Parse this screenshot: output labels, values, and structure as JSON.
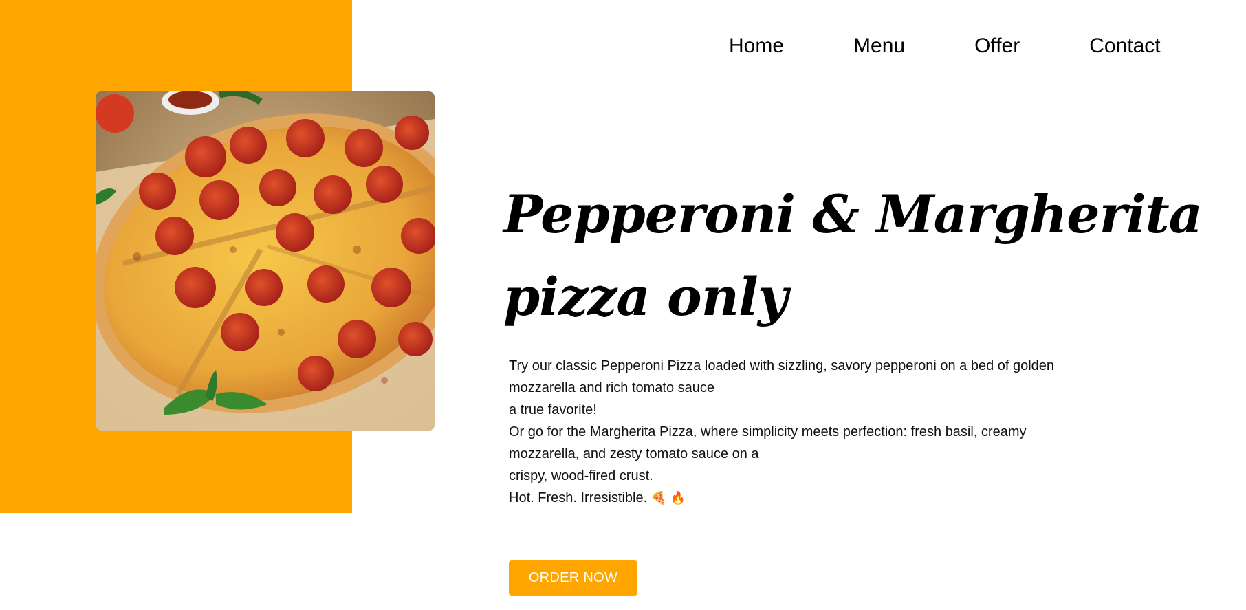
{
  "nav": {
    "items": [
      {
        "label": "Home"
      },
      {
        "label": "Menu"
      },
      {
        "label": "Offer"
      },
      {
        "label": "Contact"
      }
    ]
  },
  "hero": {
    "image_alt": "Pepperoni pizza on parchment paper",
    "headline_line1": "Pepperoni & Margherita",
    "headline_line2": "pizza only",
    "description_lines": [
      "Try our classic Pepperoni Pizza loaded with sizzling, savory pepperoni on a bed of golden",
      "mozzarella and rich tomato sauce",
      "a true favorite!",
      "Or go for the Margherita Pizza, where simplicity meets perfection: fresh basil, creamy",
      "mozzarella, and zesty tomato sauce on a",
      "crispy, wood-fired crust.",
      "Hot. Fresh. Irresistible."
    ],
    "description_emoji": "🍕 🔥",
    "order_button_label": "ORDER NOW"
  },
  "colors": {
    "accent": "#ffa500",
    "text": "#000000",
    "background": "#ffffff"
  }
}
